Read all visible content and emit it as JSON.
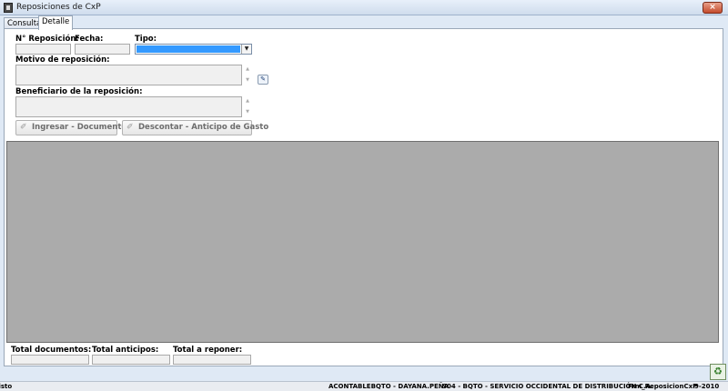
{
  "window": {
    "title": "Reposiciones de CxP",
    "close_label": "×"
  },
  "tabs": [
    {
      "label": "Consulta",
      "active": false
    },
    {
      "label": "Detalle",
      "active": true
    }
  ],
  "form": {
    "numero_label": "N° Reposición:",
    "numero_value": "",
    "fecha_label": "Fecha:",
    "fecha_value": "",
    "tipo_label": "Tipo:",
    "tipo_value": "",
    "motivo_label": "Motivo de reposición:",
    "motivo_value": "",
    "beneficiario_label": "Beneficiario de la reposición:",
    "beneficiario_value": ""
  },
  "buttons": {
    "ingresar": "Ingresar - Documento",
    "descontar": "Descontar - Anticipo de Gasto"
  },
  "totals": {
    "documentos_label": "Total documentos:",
    "documentos_value": "",
    "anticipos_label": "Total anticipos:",
    "anticipos_value": "",
    "reponer_label": "Total a reponer:",
    "reponer_value": ""
  },
  "status": {
    "state": "Listo",
    "user": "ACONTABLEBQTO - DAYANA.PEÑA",
    "company": "S04 - BQTO - SERVICIO OCCIDENTAL DE DISTRIBUCIÓN C.A.",
    "form": "Frm_ReposicionCxP",
    "period": "9-2010"
  },
  "icons": {
    "app": "document-icon",
    "search": "search-tool-icon",
    "corner": "recycle-icon"
  },
  "colors": {
    "selection": "#3399ff",
    "grid_background": "#ababab",
    "window_background": "#dfe9f5"
  }
}
